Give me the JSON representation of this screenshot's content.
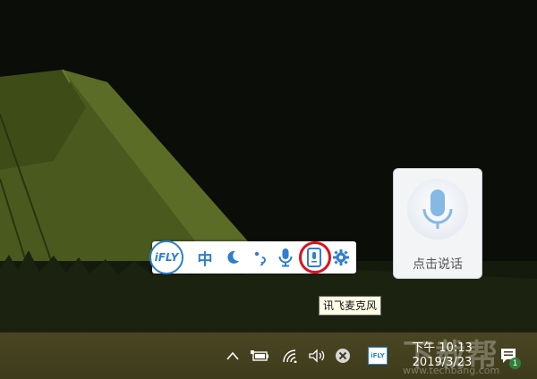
{
  "desktop": {
    "wallpaper": "night-tent-wallpaper"
  },
  "ifly_toolbar": {
    "logo_text": "iFLY",
    "buttons": [
      {
        "name": "language-toggle-button",
        "label": "中"
      },
      {
        "name": "half-width-moon-icon"
      },
      {
        "name": "punctuation-mode-icon"
      },
      {
        "name": "microphone-icon"
      },
      {
        "name": "ifly-microphone-app-icon",
        "highlighted": true
      },
      {
        "name": "gear-icon"
      }
    ],
    "accent": "#2f7fcf"
  },
  "tooltip": {
    "text": "讯飞麦克风"
  },
  "voice_panel": {
    "label": "点击说话"
  },
  "taskbar": {
    "tray_icons": [
      "chevron-up-icon",
      "battery-icon",
      "wifi-icon",
      "volume-icon",
      "close-circle-icon",
      "ifly-tray-icon"
    ],
    "ifly_tray_label": "iFLY",
    "clock": {
      "time": "下午 10:13",
      "date": "2019/3/23"
    },
    "notification_icon": "notification-icon",
    "notification_count": "1"
  },
  "watermark": {
    "text": "下载帮",
    "domain": "www.techbang.com"
  },
  "colors": {
    "highlight_ring": "#e0101a",
    "taskbar": "#433f1f"
  }
}
